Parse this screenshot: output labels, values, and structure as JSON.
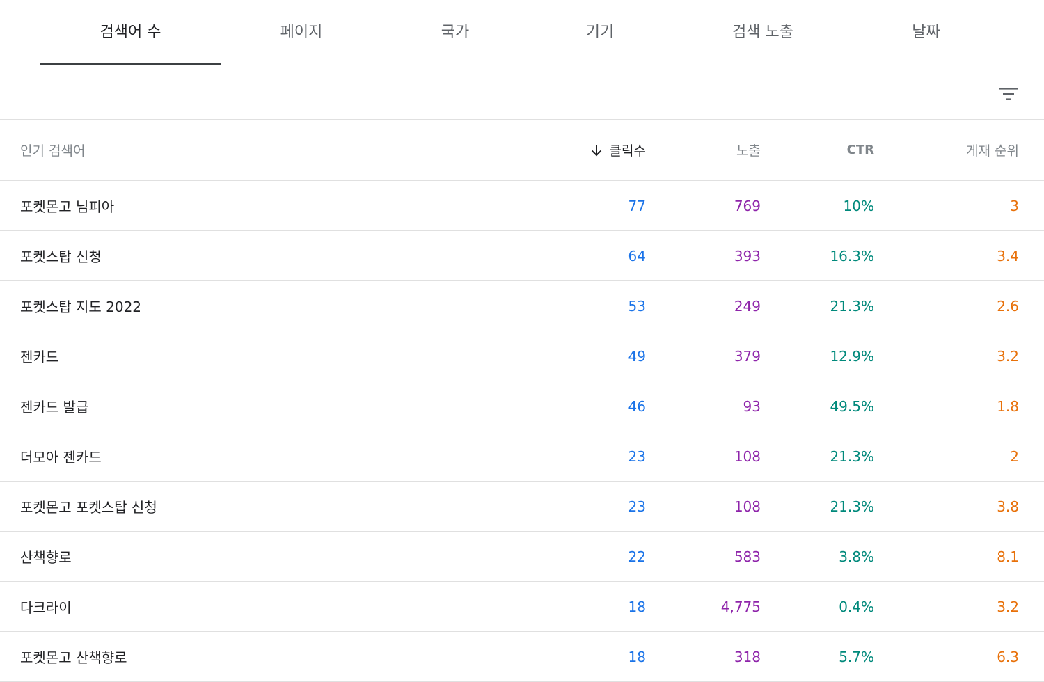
{
  "tabs": [
    {
      "label": "검색어 수",
      "active": true
    },
    {
      "label": "페이지",
      "active": false
    },
    {
      "label": "국가",
      "active": false
    },
    {
      "label": "기기",
      "active": false
    },
    {
      "label": "검색 노출",
      "active": false
    },
    {
      "label": "날짜",
      "active": false
    }
  ],
  "toolbar": {
    "filter_icon": "filter-list-icon"
  },
  "table": {
    "headers": {
      "query": "인기 검색어",
      "clicks": "클릭수",
      "impressions": "노출",
      "ctr": "CTR",
      "position": "게재 순위"
    },
    "sort_icon": "arrow-downward-icon",
    "rows": [
      {
        "query": "포켓몬고 님피아",
        "clicks": "77",
        "impressions": "769",
        "ctr": "10%",
        "position": "3"
      },
      {
        "query": "포켓스탑 신청",
        "clicks": "64",
        "impressions": "393",
        "ctr": "16.3%",
        "position": "3.4"
      },
      {
        "query": "포켓스탑 지도 2022",
        "clicks": "53",
        "impressions": "249",
        "ctr": "21.3%",
        "position": "2.6"
      },
      {
        "query": "젠카드",
        "clicks": "49",
        "impressions": "379",
        "ctr": "12.9%",
        "position": "3.2"
      },
      {
        "query": "젠카드 발급",
        "clicks": "46",
        "impressions": "93",
        "ctr": "49.5%",
        "position": "1.8"
      },
      {
        "query": "더모아 젠카드",
        "clicks": "23",
        "impressions": "108",
        "ctr": "21.3%",
        "position": "2"
      },
      {
        "query": "포켓몬고 포켓스탑 신청",
        "clicks": "23",
        "impressions": "108",
        "ctr": "21.3%",
        "position": "3.8"
      },
      {
        "query": "산책향로",
        "clicks": "22",
        "impressions": "583",
        "ctr": "3.8%",
        "position": "8.1"
      },
      {
        "query": "다크라이",
        "clicks": "18",
        "impressions": "4,775",
        "ctr": "0.4%",
        "position": "3.2"
      },
      {
        "query": "포켓몬고 산책향로",
        "clicks": "18",
        "impressions": "318",
        "ctr": "5.7%",
        "position": "6.3"
      }
    ]
  },
  "colors": {
    "clicks": "#1a73e8",
    "impressions": "#8e24aa",
    "ctr": "#00897b",
    "position": "#e8710a",
    "active_tab_indicator": "#3c4043"
  }
}
